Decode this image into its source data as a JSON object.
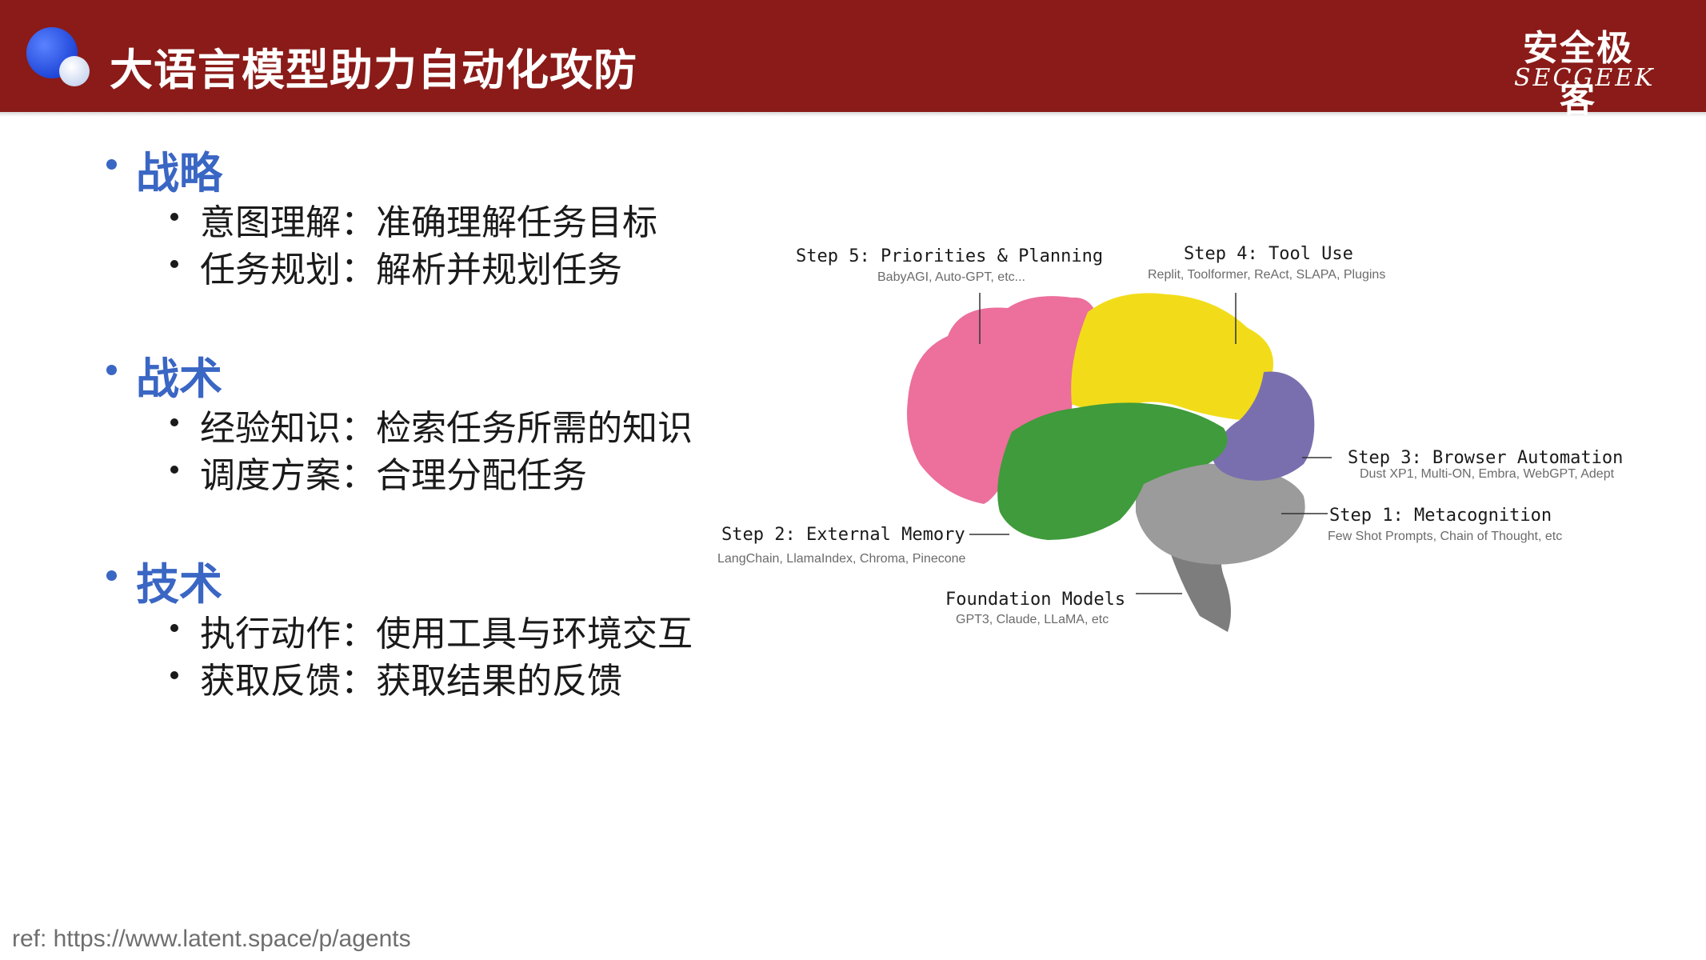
{
  "header": {
    "title": "大语言模型助力自动化攻防",
    "logo_cn": "安全极客",
    "logo_en": "SECGEEK"
  },
  "sections": [
    {
      "title": "战略",
      "items": [
        "意图理解：准确理解任务目标",
        "任务规划：解析并规划任务"
      ]
    },
    {
      "title": "战术",
      "items": [
        "经验知识：检索任务所需的知识",
        "调度方案：合理分配任务"
      ]
    },
    {
      "title": "技术",
      "items": [
        "执行动作：使用工具与环境交互",
        "获取反馈：获取结果的反馈"
      ]
    }
  ],
  "diagram": {
    "labels": [
      {
        "title": "Step 5: Priorities & Planning",
        "sub": "BabyAGI, Auto-GPT, etc..."
      },
      {
        "title": "Step 4: Tool Use",
        "sub": "Replit, Toolformer, ReAct, SLAPA, Plugins"
      },
      {
        "title": "Step 3: Browser Automation",
        "sub": "Dust XP1, Multi-ON, Embra, WebGPT, Adept"
      },
      {
        "title": "Step 1: Metacognition",
        "sub": "Few Shot Prompts, Chain of Thought, etc"
      },
      {
        "title": "Step 2: External Memory",
        "sub": "LangChain, LlamaIndex, Chroma, Pinecone"
      },
      {
        "title": "Foundation Models",
        "sub": "GPT3, Claude, LLaMA, etc"
      }
    ],
    "region_colors": {
      "frontal": "#ec6f9c",
      "parietal": "#f2dc1a",
      "occipital": "#7a6fae",
      "temporal": "#3f9b3b",
      "cerebellum": "#9b9b9b",
      "brainstem": "#7d7d7d"
    }
  },
  "footer": {
    "ref": "ref: https://www.latent.space/p/agents"
  }
}
